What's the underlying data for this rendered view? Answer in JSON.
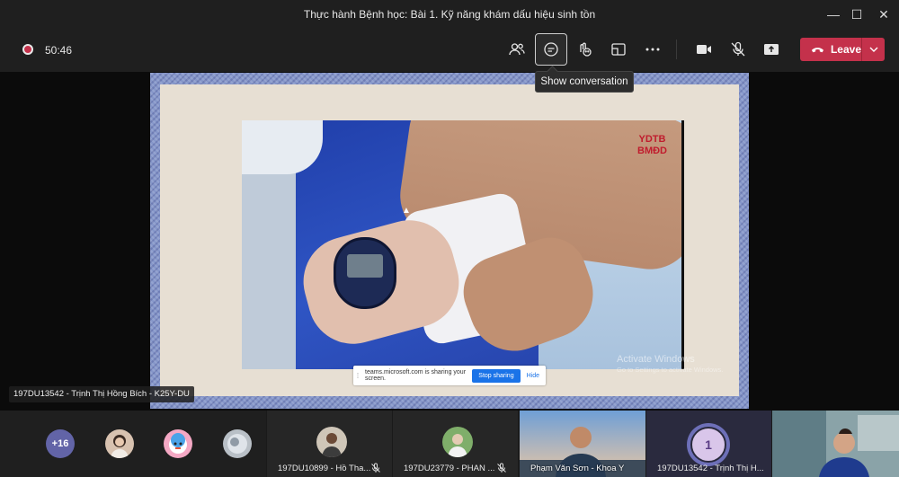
{
  "window": {
    "title": "Thực hành Bệnh học: Bài 1. Kỹ năng khám dấu hiệu sinh tồn",
    "minimize_glyph": "—",
    "maximize_glyph": "☐",
    "close_glyph": "✕"
  },
  "toolbar": {
    "timer": "50:46",
    "leave_label": "Leave",
    "tooltip": "Show conversation",
    "buttons": [
      "participants-icon",
      "chat-icon",
      "reactions-icon",
      "rooms-icon",
      "more-icon",
      "camera-icon",
      "mic-off-icon",
      "share-icon"
    ]
  },
  "stage": {
    "video_watermark_line1": "YDTB",
    "video_watermark_line2": "BMĐD",
    "share_bar": {
      "grip": "⁞",
      "message": "teams.microsoft.com is sharing your screen.",
      "stop_label": "Stop sharing",
      "hide_label": "Hide"
    },
    "activate_line1": "Activate Windows",
    "activate_line2": "Go to Settings to activate Windows.",
    "presenter_label": "197DU13542 - Trịnh Thị Hồng Bích - K25Y-DU"
  },
  "gallery": {
    "more_count": "+16",
    "tiles": [
      {
        "name": "197DU10899 - Hồ Tha..."
      },
      {
        "name": "197DU23779 - PHAN ..."
      },
      {
        "name": "Phạm Văn Sơn - Khoa Y"
      },
      {
        "name": "197DU13542 - Trịnh Thị H...",
        "initial": "1"
      }
    ]
  },
  "colors": {
    "leave": "#c4314b",
    "accent": "#6264a7",
    "share_button": "#1a73e8"
  }
}
